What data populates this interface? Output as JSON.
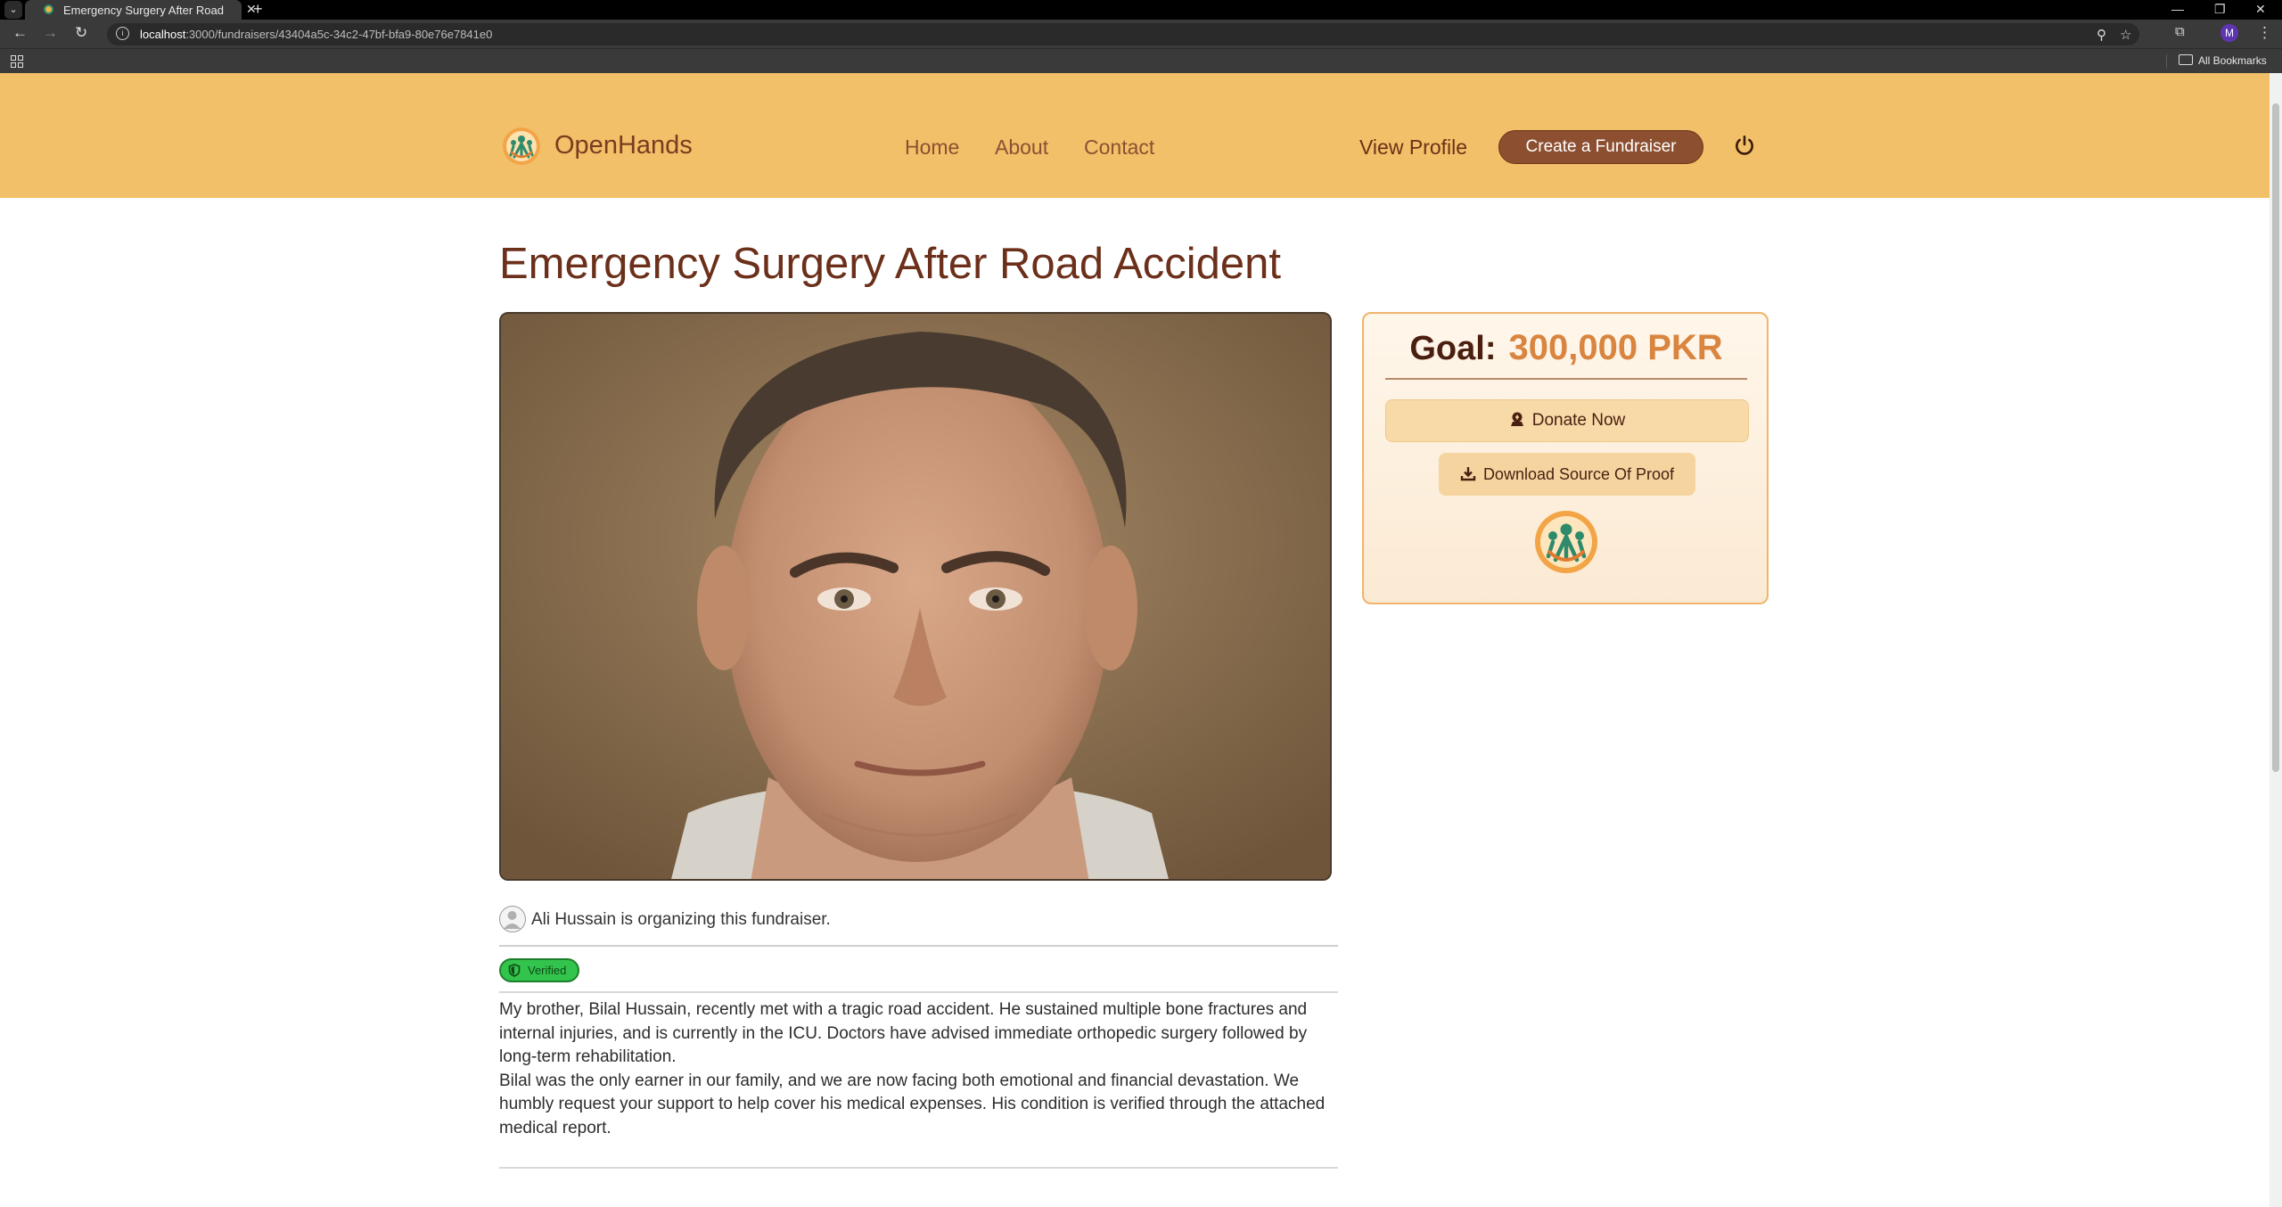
{
  "browser": {
    "tab_title": "Emergency Surgery After Road",
    "url_host": "localhost",
    "url_path": ":3000/fundraisers/43404a5c-34c2-47bf-bfa9-80e76e7841e0",
    "profile_initial": "M",
    "all_bookmarks": "All Bookmarks"
  },
  "header": {
    "brand": "OpenHands",
    "nav": [
      "Home",
      "About",
      "Contact"
    ],
    "view_profile": "View Profile",
    "create_label": "Create a Fundraiser"
  },
  "fundraiser": {
    "title": "Emergency Surgery After Road Accident",
    "organizer_text": "Ali Hussain is organizing this fundraiser.",
    "verified_label": "Verified",
    "story": [
      "My brother, Bilal Hussain, recently met with a tragic road accident. He sustained multiple bone fractures and internal injuries, and is currently in the ICU. Doctors have advised immediate orthopedic surgery followed by long-term rehabilitation.",
      "Bilal was the only earner in our family, and we are now facing both emotional and financial devastation. We humbly request your support to help cover his medical expenses. His condition is verified through the attached medical report."
    ]
  },
  "goal_card": {
    "goal_label": "Goal:",
    "goal_value": "300,000 PKR",
    "donate_label": "Donate Now",
    "proof_label": "Download Source Of Proof"
  },
  "colors": {
    "header_bg": "#f2c069",
    "brand_text": "#7a3c1f",
    "button_brown": "#8c4f30",
    "goal_value": "#d9853f",
    "verified_green": "#32c44c",
    "logo_teal": "#2f8a6b"
  },
  "icons": [
    "power-icon",
    "donate-icon",
    "download-icon",
    "shield-icon",
    "user-avatar-icon",
    "openhands-logo"
  ]
}
